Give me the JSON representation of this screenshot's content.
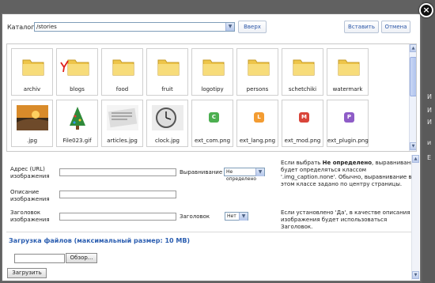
{
  "backdrop": {
    "letters": [
      "И",
      "И",
      "И",
      "и",
      "Е"
    ]
  },
  "close_icon": "close-icon",
  "top_bar": {
    "catalog_label": "Каталог",
    "catalog_value": "/stories",
    "up_button": "Вверх",
    "insert_button": "Вставить",
    "cancel_button": "Отмена"
  },
  "gallery": {
    "row1": [
      {
        "label": "archiv",
        "icon": "folder-icon"
      },
      {
        "label": "blogs",
        "icon": "folder-icon"
      },
      {
        "label": "food",
        "icon": "folder-icon"
      },
      {
        "label": "fruit",
        "icon": "folder-icon"
      },
      {
        "label": "logotipy",
        "icon": "folder-icon"
      },
      {
        "label": "persons",
        "icon": "folder-icon"
      },
      {
        "label": "schetchiki",
        "icon": "folder-icon"
      },
      {
        "label": "watermark",
        "icon": "folder-icon"
      }
    ],
    "row2": [
      {
        "label": ".jpg",
        "icon": "image-thumbnail"
      },
      {
        "label": "File023.gif",
        "icon": "image-thumbnail"
      },
      {
        "label": "articles.jpg",
        "icon": "image-thumbnail"
      },
      {
        "label": "clock.jpg",
        "icon": "image-thumbnail"
      },
      {
        "label": "ext_com.png",
        "icon": "component-icon",
        "badge": "C",
        "color": "#4caf50"
      },
      {
        "label": "ext_lang.png",
        "icon": "language-icon",
        "badge": "L",
        "color": "#f39c32"
      },
      {
        "label": "ext_mod.png",
        "icon": "module-icon",
        "badge": "M",
        "color": "#d9453a"
      },
      {
        "label": "ext_plugin.png",
        "icon": "plugin-icon",
        "badge": "P",
        "color": "#8e5cc7"
      }
    ]
  },
  "form": {
    "url_label": "Адрес (URL)",
    "url_label2": "изображения",
    "desc_label": "Описание",
    "desc_label2": "изображения",
    "title_label": "Заголовок",
    "title_label2": "изображения",
    "align_label": "Выравнивание",
    "align_value": "Не определено",
    "caption_label": "Заголовок",
    "caption_value": "Нет",
    "note1_prefix": "Если выбрать ",
    "note1_bold": "Не определено",
    "note1_suffix": ", выравнивание",
    "note1_line2": "будет определяться классом",
    "note1_line3": "'.img_caption.none'. Обычно, выравнивание в",
    "note1_line4": "этом классе задано по центру страницы.",
    "note2_line1": "Если установлено 'Да', в качестве описания",
    "note2_line2": "изображения будет использоваться Заголовок."
  },
  "upload": {
    "title": "Загрузка файлов (максимальный размер: 10 MB)",
    "browse_button": "Обзор...",
    "upload_button": "Загрузить"
  }
}
